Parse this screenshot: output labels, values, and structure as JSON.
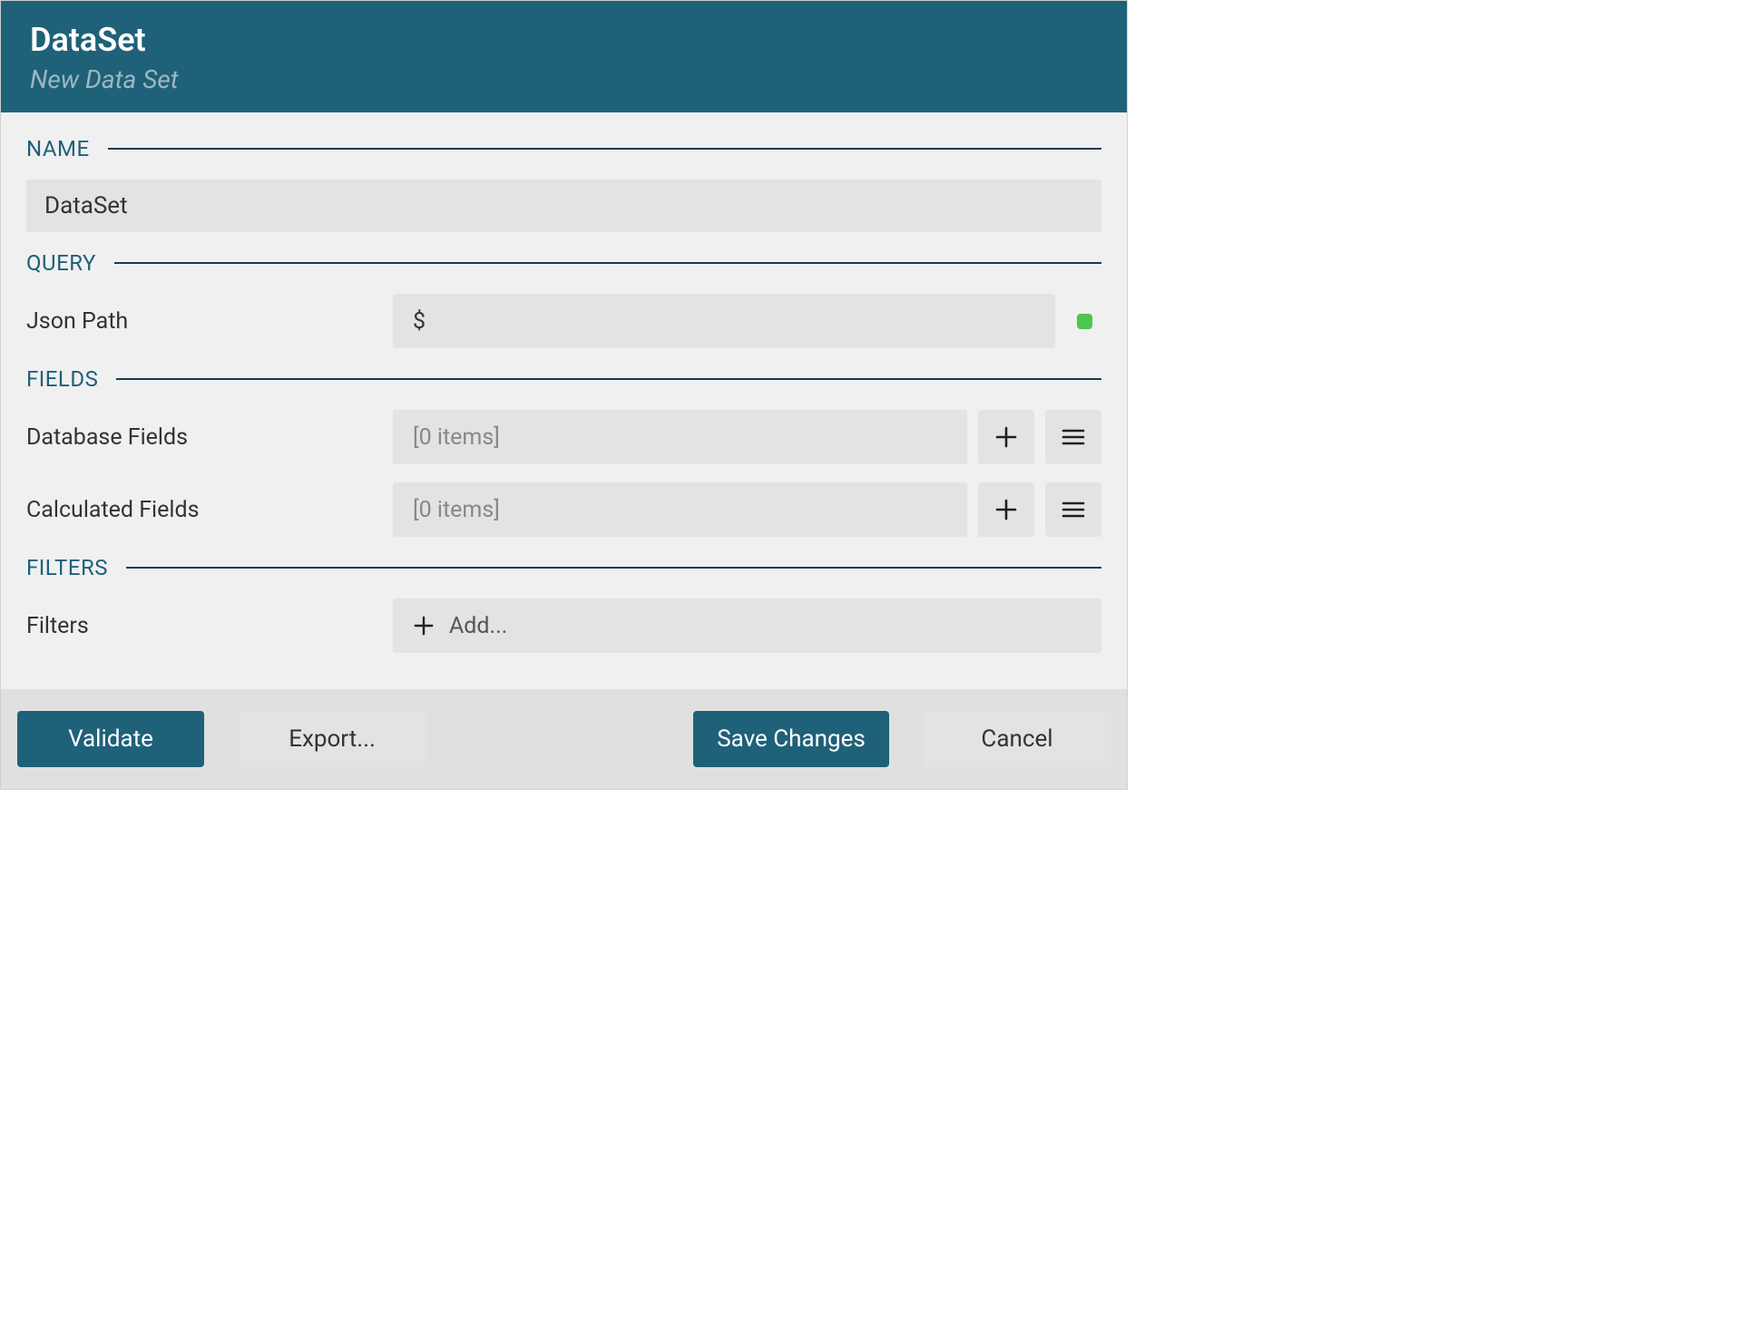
{
  "header": {
    "title": "DataSet",
    "subtitle": "New Data Set"
  },
  "sections": {
    "name": {
      "label": "NAME",
      "value": "DataSet"
    },
    "query": {
      "label": "QUERY",
      "json_path_label": "Json Path",
      "json_path_value": "$",
      "status": "valid",
      "status_color": "#4ec64e"
    },
    "fields": {
      "label": "FIELDS",
      "database_label": "Database Fields",
      "database_value": "[0 items]",
      "calculated_label": "Calculated Fields",
      "calculated_value": "[0 items]"
    },
    "filters": {
      "label": "FILTERS",
      "row_label": "Filters",
      "add_label": "Add..."
    }
  },
  "footer": {
    "validate": "Validate",
    "export": "Export...",
    "save": "Save Changes",
    "cancel": "Cancel"
  },
  "icons": {
    "plus": "plus-icon",
    "menu": "menu-icon"
  }
}
